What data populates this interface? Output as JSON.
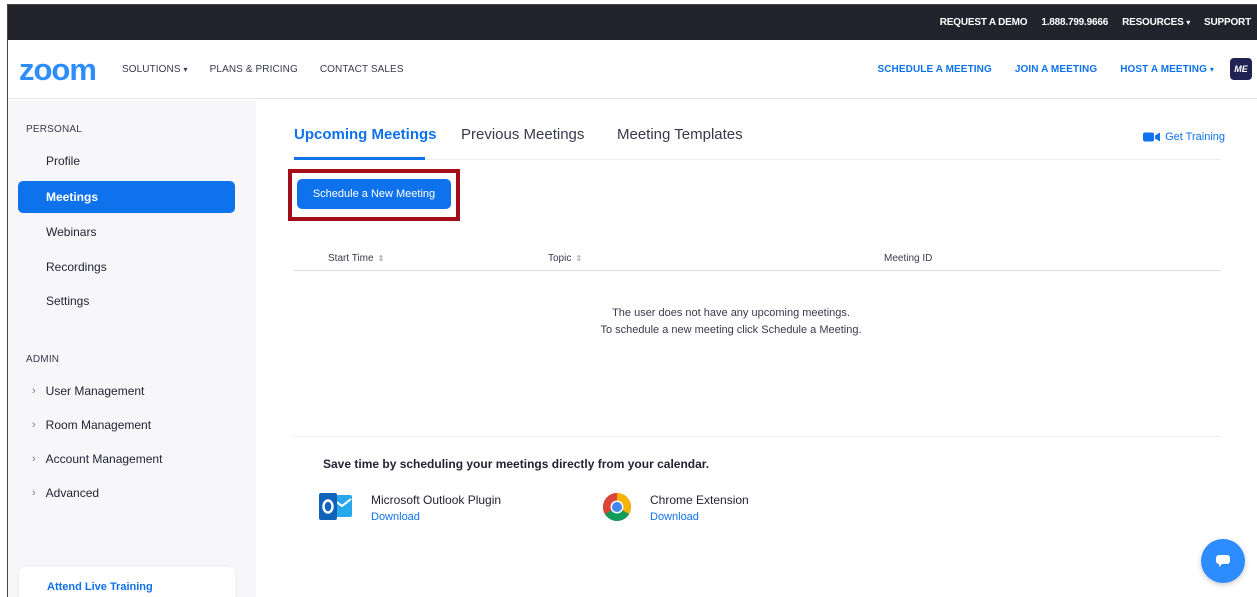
{
  "utility_bar": {
    "request_demo": "REQUEST A DEMO",
    "phone": "1.888.799.9666",
    "resources": "RESOURCES",
    "support": "SUPPORT"
  },
  "header": {
    "logo": "zoom",
    "nav_left": [
      "SOLUTIONS",
      "PLANS & PRICING",
      "CONTACT SALES"
    ],
    "nav_right": [
      "SCHEDULE A MEETING",
      "JOIN A MEETING",
      "HOST A MEETING"
    ],
    "avatar_initials": "ME"
  },
  "sidebar": {
    "personal_label": "PERSONAL",
    "personal_items": [
      "Profile",
      "Meetings",
      "Webinars",
      "Recordings",
      "Settings"
    ],
    "active_item": "Meetings",
    "admin_label": "ADMIN",
    "admin_items": [
      "User Management",
      "Room Management",
      "Account Management",
      "Advanced"
    ],
    "live_training": "Attend Live Training"
  },
  "tabs": [
    "Upcoming Meetings",
    "Previous Meetings",
    "Meeting Templates"
  ],
  "get_training": "Get Training",
  "schedule_button": "Schedule a New Meeting",
  "table": {
    "columns": [
      "Start Time",
      "Topic",
      "Meeting ID"
    ]
  },
  "empty_state": {
    "line1": "The user does not have any upcoming meetings.",
    "line2": "To schedule a new meeting click Schedule a Meeting."
  },
  "calendar": {
    "title": "Save time by scheduling your meetings directly from your calendar.",
    "plugins": [
      {
        "name": "Microsoft Outlook Plugin",
        "action": "Download"
      },
      {
        "name": "Chrome Extension",
        "action": "Download"
      }
    ]
  },
  "colors": {
    "brand_blue": "#0e72ed",
    "logo_blue": "#2d8cff",
    "topbar": "#23232e",
    "highlight_box": "#a30d1a"
  },
  "icons": [
    "video-camera-icon",
    "outlook-icon",
    "chrome-icon",
    "chat-icon"
  ]
}
